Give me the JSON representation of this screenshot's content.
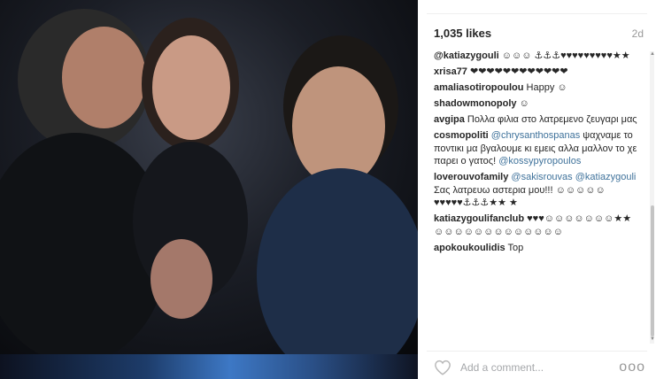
{
  "post": {
    "likes": "1,035 likes",
    "time": "2d"
  },
  "comments": [
    {
      "user": "@katiazygouli",
      "user_is_mention": true,
      "text": " ☺☺☺ ⚓⚓⚓♥♥♥♥♥♥♥♥♥★★"
    },
    {
      "user": "xrisa77",
      "text": " ❤❤❤❤❤❤❤❤❤❤❤❤"
    },
    {
      "user": "amaliasotiropoulou",
      "text": " Happy ☺"
    },
    {
      "user": "shadowmonopoly",
      "text": " ☺"
    },
    {
      "user": "avgipa",
      "text": " Πολλα φιλια στο λατρεμενο ζευγαρι μας"
    },
    {
      "user": "cosmopoliti",
      "mention1": "@chrysanthospanas",
      "text": " ψαχναμε το ποντικι μα βγαλουμε κι εμεις αλλα μαλλον το χε παρει ο γατος!",
      "mention2": "@kossypyropoulos"
    },
    {
      "user": "loverouvofamily",
      "mention1": "@sakisrouvas",
      "mention2": "@katiazygouli",
      "text": " Σας λατρευω αστερια μου!!! ☺☺☺☺☺♥♥♥♥♥⚓⚓⚓★★ ★"
    },
    {
      "user": "katiazygoulifanclub",
      "text": " ♥♥♥☺☺☺☺☺☺☺★★☺☺☺☺☺☺☺☺☺☺☺☺☺"
    },
    {
      "user": "apokoukoulidis",
      "text": " Top"
    }
  ],
  "compose": {
    "placeholder": "Add a comment...",
    "more_label": "ooo"
  },
  "icons": {
    "like": "heart-outline-icon",
    "more": "ellipsis-icon"
  },
  "colors": {
    "mention": "#3f729b",
    "username": "#262626",
    "muted": "#999999"
  }
}
